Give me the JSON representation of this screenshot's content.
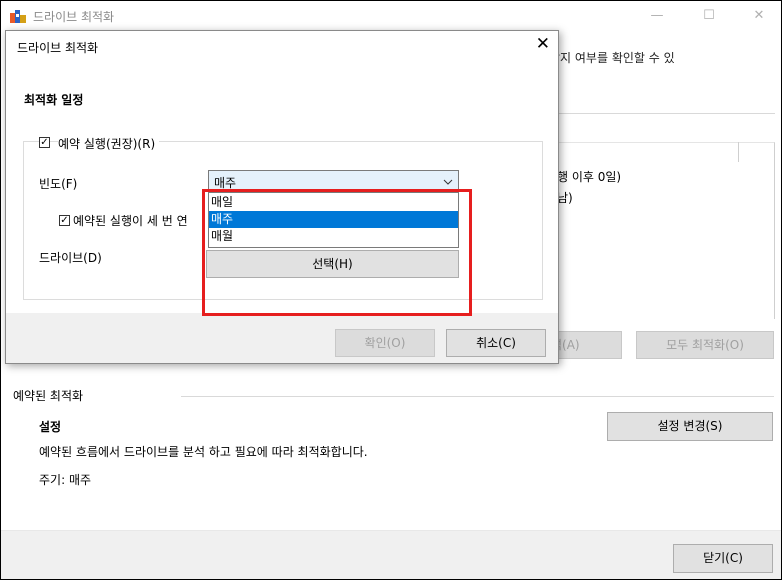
{
  "outer": {
    "title": "드라이브 최적화",
    "minimize": "—",
    "maximize": "☐",
    "close": "✕",
    "description_partial": "할지 여부를 확인할 수 있",
    "list_line1": "행 이후 0일)",
    "list_line2": "남)",
    "analyze_partial": "석(A)",
    "optimize_all_label": "모두 최적화(O)",
    "scheduled_section_title": "예약된 최적화",
    "settings_label": "설정",
    "settings_description": "예약된 흐름에서 드라이브를 분석 하고 필요에 따라 최적화합니다.",
    "frequency_text": "주기: 매주",
    "change_settings_label": "설정 변경(S)",
    "close_label": "닫기(C)"
  },
  "dialog": {
    "title": "드라이브 최적화",
    "close": "✕",
    "heading": "최적화 일정",
    "run_on_schedule_label": "예약 실행(권장)(R)",
    "run_on_schedule_checked": true,
    "frequency_label": "빈도(F)",
    "frequency_selected": "매주",
    "frequency_options": [
      "매일",
      "매주",
      "매월"
    ],
    "notify_label": "예약된 실행이 세 번 연",
    "notify_checked": true,
    "drives_label": "드라이브(D)",
    "choose_label": "선택(H)",
    "ok_label": "확인(O)",
    "cancel_label": "취소(C)"
  },
  "colors": {
    "highlight_box": "#e61e1e",
    "selection": "#0078d7"
  }
}
